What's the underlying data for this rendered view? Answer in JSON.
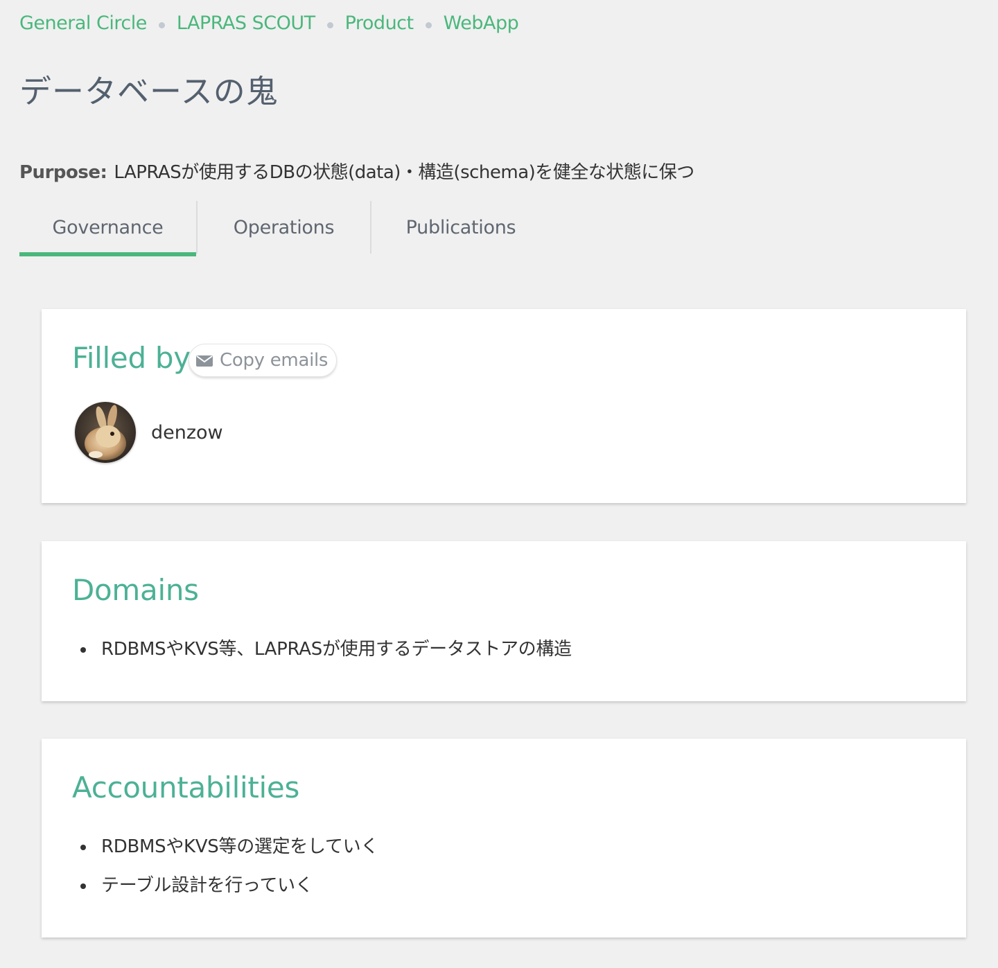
{
  "breadcrumb": {
    "items": [
      {
        "label": "General Circle"
      },
      {
        "label": "LAPRAS SCOUT"
      },
      {
        "label": "Product"
      },
      {
        "label": "WebApp"
      }
    ]
  },
  "title": "データベースの鬼",
  "purpose": {
    "label": "Purpose:",
    "text": "LAPRASが使用するDBの状態(data)・構造(schema)を健全な状態に保つ"
  },
  "tabs": [
    {
      "label": "Governance",
      "active": true
    },
    {
      "label": "Operations",
      "active": false
    },
    {
      "label": "Publications",
      "active": false
    }
  ],
  "filled_by": {
    "title": "Filled by",
    "copy_button": {
      "label": "Copy emails",
      "icon": "envelope-icon"
    },
    "members": [
      {
        "name": "denzow"
      }
    ]
  },
  "domains": {
    "title": "Domains",
    "items": [
      "RDBMSやKVS等、LAPRASが使用するデータストアの構造"
    ]
  },
  "accountabilities": {
    "title": "Accountabilities",
    "items": [
      "RDBMSやKVS等の選定をしていく",
      "テーブル設計を行っていく"
    ]
  },
  "colors": {
    "accent_green": "#4ab77c",
    "card_title_teal": "#4cb195",
    "title_slate": "#54606e",
    "background": "#f0f0f0"
  }
}
